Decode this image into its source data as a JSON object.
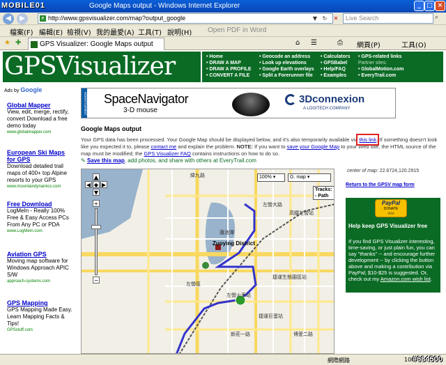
{
  "window": {
    "watermark": "MOBILE01",
    "title": "Google Maps output - Windows Internet Explorer"
  },
  "addressbar": {
    "url": "http://www.gpsvisualizer.com/map?output_google",
    "search_placeholder": "Live Search"
  },
  "menu": {
    "items": [
      "檔案(F)",
      "編輯(E)",
      "檢視(V)",
      "我的最愛(A)",
      "工具(T)",
      "說明(H)"
    ],
    "pdf_button": "Open PDF in Word"
  },
  "tabbar": {
    "tab_title": "GPS Visualizer: Google Maps output",
    "page_menu": "網頁(P)",
    "tools_menu": "工具(O)"
  },
  "header": {
    "logo_text": "GPSVisualizer",
    "nav_col1": [
      "• Home",
      "• DRAW A MAP",
      "• DRAW A PROFILE",
      "• CONVERT A FILE"
    ],
    "nav_col2": [
      "• Geocode an address",
      "• Look up elevations",
      "• Google Earth overlays",
      "• Split a Forerunner file"
    ],
    "nav_col3": [
      "• Calculators",
      "• GPSBabel",
      "• Help/FAQ",
      "• Examples"
    ],
    "nav_col4": [
      "• GPS-related links",
      "Partner sites:",
      "• GlobalMotion.com",
      "• EveryTrail.com"
    ]
  },
  "ads": {
    "label_prefix": "Ads by",
    "label_brand": "Google",
    "items": [
      {
        "title": "Global Mapper",
        "body": "View, edit, merge, rectify, convert Download a free demo today",
        "url": "www.globalmapper.com"
      },
      {
        "title": "European Ski Maps for GPS",
        "body": "Download detailed trail maps of 400+ top Alpine resorts to your GPS",
        "url": "www.mountaindynamics.com"
      },
      {
        "title": "Free Download",
        "body": "LogMeIn - Really 100% Free & Easy Access PCs From Any PC or PDA",
        "url": "www.LogMeIn.com"
      },
      {
        "title": "Aviation GPS",
        "body": "Moving map software for Windows Approach APIC S/W",
        "url": "approach-systems.com"
      },
      {
        "title": "GPS Mapping",
        "body": "GPS Mapping Made Easy. Learn Mapping Facts & Tips!",
        "url": "GPSstuff.com"
      }
    ]
  },
  "banner": {
    "product": "SpaceNavigator",
    "tagline": "3-D mouse",
    "brand": "3Dconnexion",
    "brand_sub": "A LOGITECH COMPANY",
    "side": "ADVERTISEMENT"
  },
  "main": {
    "title": "Google Maps output",
    "para_a": "Your GPS data has been processed. Your Google Map should be displayed below, and it's also temporarily available via",
    "link_this": "this link",
    "para_b": ". If something doesn't look like you expected it to, please",
    "link_contact": "contact me",
    "para_c": "and explain the problem.",
    "note_label": "NOTE:",
    "para_d": "If you want to",
    "link_save": "save your Google Map",
    "para_e": "to your Web site, the HTML source of the map must be modified; the",
    "link_faq": "GPS Visualizer FAQ",
    "para_f": "contains instructions on how to do so.",
    "save_link": "Save this map",
    "save_rest": ", add photos, and share with others at EveryTrail.com"
  },
  "map": {
    "zoom_select": "100%",
    "type_select": "G. map",
    "tracks_label": "Tracks:",
    "tracks_value": "- Path",
    "labels": [
      "緯九路",
      "左營大路",
      "高鐵左營站",
      "蓮池潭",
      "Zuoying District",
      "左營區",
      "左營火車站",
      "捷運生態園區站",
      "捷運巨蛋站",
      "新莊一路",
      "博愛二路"
    ]
  },
  "sidebar": {
    "center_label": "center of map:",
    "center_value": "22.6724,120.2915",
    "return_link": "Return to the GPSV map form",
    "paypal_brand": "PayPal",
    "paypal_donate": "DONATE",
    "paypal_cards": "VISA",
    "donate_title": "Help keep GPS Visualizer free",
    "donate_body_a": "If you find GPS Visualizer interesting, time-saving, or just plain fun, you can say \"thanks\" -- and encourage further development -- by clicking the button above and making a contribution via PayPal; $10-$25 is suggested. Or, check out my",
    "donate_link": "Amazon.com wish list",
    "donate_body_b": "."
  },
  "statusbar": {
    "zone": "網際網路",
    "zoom": "100%",
    "watermark": "#684500"
  }
}
